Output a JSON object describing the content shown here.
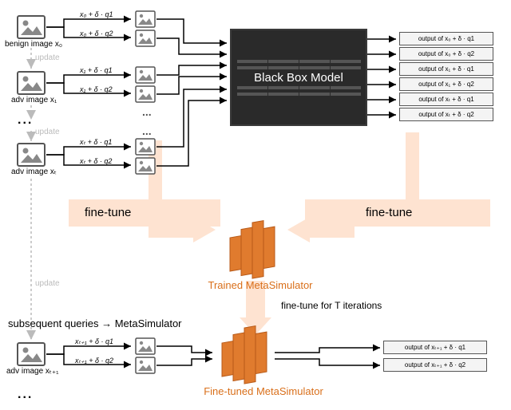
{
  "images": {
    "col1": [
      {
        "caption": "benign image x₀"
      },
      {
        "caption": "adv image x₁"
      },
      {
        "caption": "adv image xₜ"
      },
      {
        "caption": "adv image xₜ₊₁"
      }
    ],
    "update_label": "update"
  },
  "formulas": {
    "row0": [
      "x₀ + δ · q1",
      "x₀ + δ · q2"
    ],
    "row1": [
      "x₁ + δ · q1",
      "x₁ + δ · q2"
    ],
    "row2": [
      "xₜ + δ · q1",
      "xₜ + δ · q2"
    ],
    "row3": [
      "xₜ₊₁ + δ · q1",
      "xₜ₊₁ + δ · q2"
    ]
  },
  "blackbox": {
    "title": "Black Box Model"
  },
  "outputs": {
    "top": [
      "output of  x₀ + δ · q1",
      "output of  x₀ + δ · q2",
      "output of  x₁ + δ · q1",
      "output of  x₁ + δ · q2",
      "output of  xₜ + δ · q1",
      "output of  xₜ + δ · q2"
    ],
    "bottom": [
      "output of xₜ₊₁ + δ · q1",
      "output of xₜ₊₁ + δ · q2"
    ]
  },
  "finetune": {
    "left": "fine-tune",
    "right": "fine-tune",
    "iter": "fine-tune for T iterations"
  },
  "sim": {
    "trained": "Trained MetaSimulator",
    "tuned": "Fine-tuned MetaSimulator"
  },
  "subsequent": "subsequent queries → MetaSimulator",
  "dots": "..."
}
